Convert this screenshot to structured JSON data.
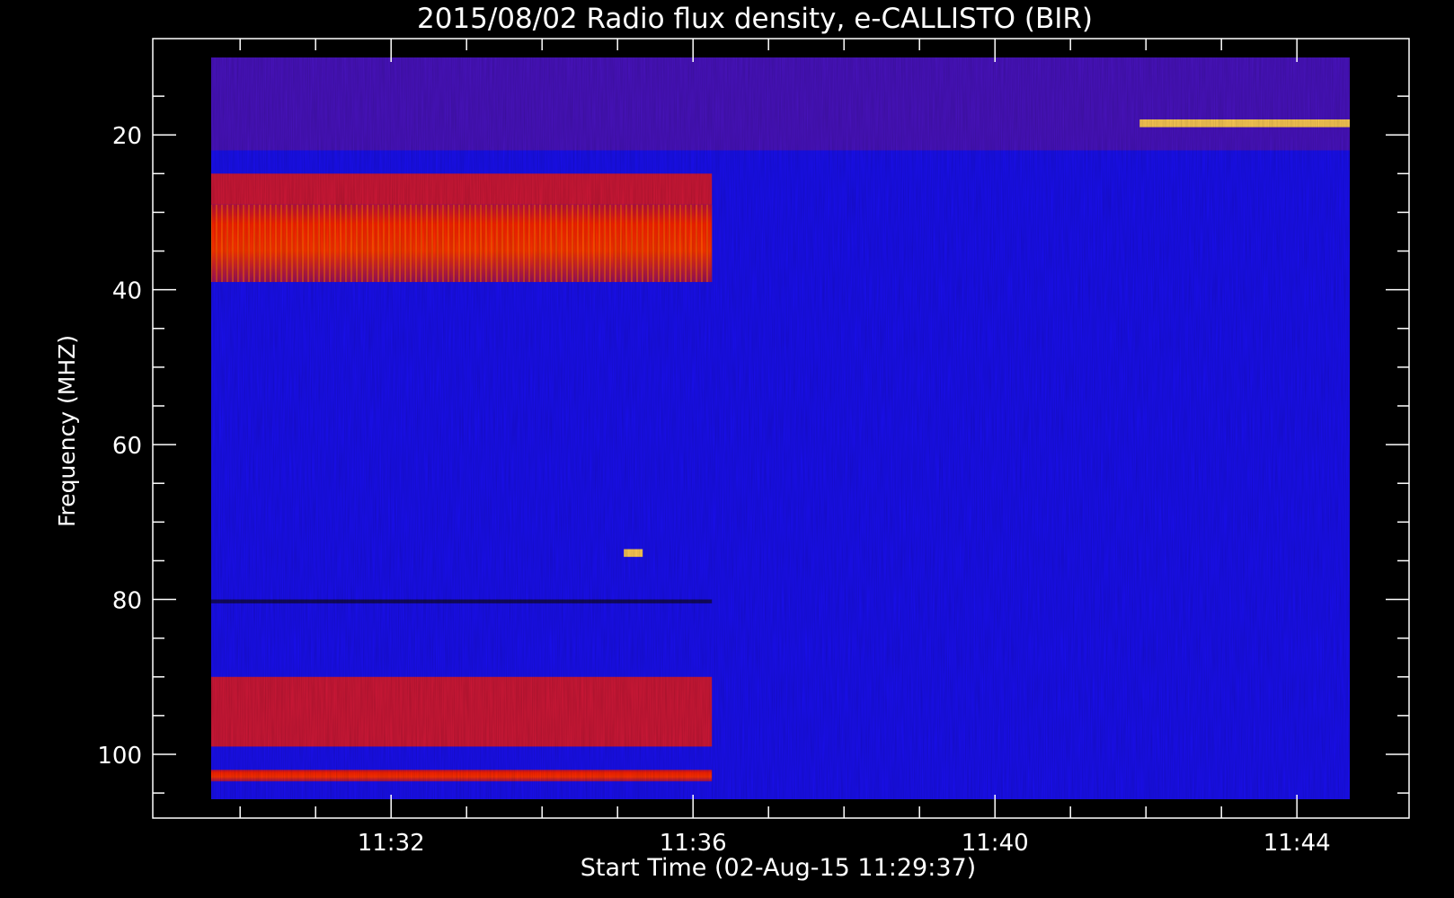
{
  "chart_data": {
    "type": "heatmap",
    "title": "2015/08/02  Radio flux density, e-CALLISTO (BIR)",
    "xlabel": "Start Time (02-Aug-15 11:29:37)",
    "ylabel": "Frequency (MHZ)",
    "x_range_minutes": [
      "11:29:37",
      "11:44:42"
    ],
    "y_range_mhz": [
      10,
      105.8
    ],
    "y_inverted": true,
    "x_ticks": [
      "11:32",
      "11:36",
      "11:40",
      "11:44"
    ],
    "y_ticks": [
      "20",
      "40",
      "60",
      "80",
      "100"
    ],
    "colormap": [
      "#000000",
      "#2200ff",
      "#ff2200",
      "#ffff80"
    ],
    "background_color": "#1a10f0",
    "features": [
      {
        "time_start": "11:29:37",
        "time_end": "11:36:15",
        "freq_low": 29,
        "freq_high": 39,
        "intensity": "high"
      },
      {
        "time_start": "11:29:37",
        "time_end": "11:36:15",
        "freq_low": 25,
        "freq_high": 29,
        "intensity": "medium"
      },
      {
        "time_start": "11:29:37",
        "time_end": "11:44:42",
        "freq_low": 10,
        "freq_high": 22,
        "intensity": "mixed"
      },
      {
        "time_start": "11:41:55",
        "time_end": "11:44:42",
        "freq_low": 18,
        "freq_high": 19,
        "intensity": "very high"
      },
      {
        "time_start": "11:29:37",
        "time_end": "11:36:15",
        "freq_low": 102,
        "freq_high": 103.5,
        "intensity": "high"
      },
      {
        "time_start": "11:29:37",
        "time_end": "11:36:15",
        "freq_low": 90,
        "freq_high": 99,
        "intensity": "medium"
      },
      {
        "time_start": "11:29:37",
        "time_end": "11:36:15",
        "freq_low": 80,
        "freq_high": 80.5,
        "intensity": "low"
      },
      {
        "time_start": "11:35:05",
        "time_end": "11:35:20",
        "freq_low": 73.5,
        "freq_high": 74.5,
        "intensity": "very high"
      }
    ]
  }
}
